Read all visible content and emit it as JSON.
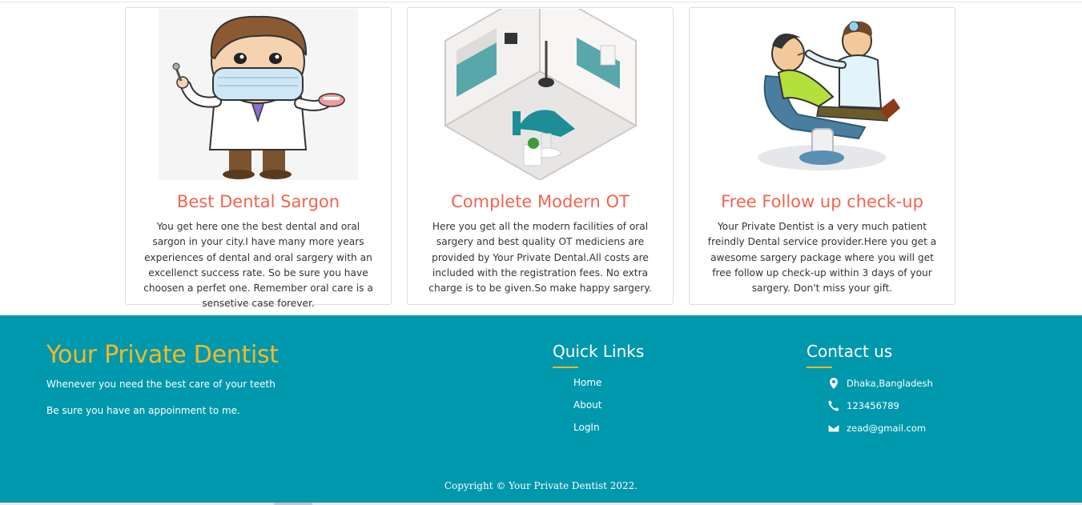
{
  "services": [
    {
      "title": "Best Dental Sargon",
      "text": "You get here one the best dental and oral sargon in your city.I have many more years experiences of dental and oral sargery with an excellenct success rate. So be sure you have choosen a perfet one. Remember oral care is a sensetive case forever.",
      "image_icon": "dentist-cartoon-icon"
    },
    {
      "title": "Complete Modern OT",
      "text": "Here you get all the modern facilities of oral sargery and best quality OT mediciens are provided by Your Private Dental.All costs are included with the registration fees. No extra charge is to be given.So make happy sargery.",
      "image_icon": "dental-room-icon"
    },
    {
      "title": "Free Follow up check-up",
      "text": "Your Private Dentist is a very much patient freindly Dental service provider.Here you get a awesome sargery package where you will get free follow up check-up within 3 days of your sargery. Don't miss your gift.",
      "image_icon": "dental-checkup-icon"
    }
  ],
  "footer": {
    "brand": "Your Private Dentist",
    "tagline1": "Whenever you need the best care of your teeth",
    "tagline2": "Be sure you have an appoinment to me.",
    "quick_links_title": "Quick Links",
    "links": [
      "Home",
      "About",
      "LogIn"
    ],
    "contact_title": "Contact us",
    "contact": {
      "address": "Dhaka,Bangladesh",
      "phone": "123456789",
      "email": "zead@gmail.com"
    },
    "copyright": "Copyright © Your Private Dentist 2022."
  },
  "colors": {
    "accent": "#f0644e",
    "footer_bg": "#0098ad",
    "brand": "#f6b826"
  }
}
